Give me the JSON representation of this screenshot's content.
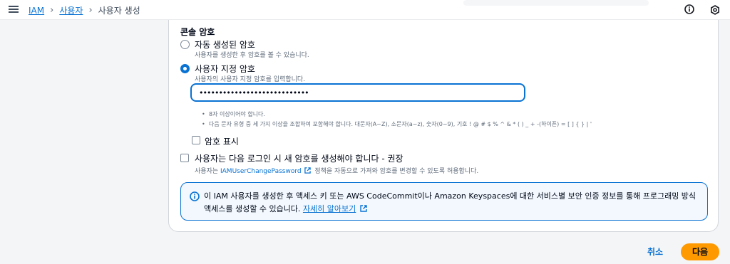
{
  "breadcrumb": {
    "iam": "IAM",
    "users": "사용자",
    "current": "사용자 생성"
  },
  "console_password": {
    "title": "콘솔 암호",
    "auto": {
      "label": "자동 생성된 암호",
      "desc": "사용자를 생성한 후 암호를 볼 수 있습니다."
    },
    "custom": {
      "label": "사용자 지정 암호",
      "desc": "사용자의 사용자 지정 암호를 입력합니다.",
      "value": "••••••••••••••••••••••••••••"
    },
    "rules": [
      "8자 이상이어야 합니다.",
      "다음 문자 유형 중 세 가지 이상을 조합하여 포함해야 합니다. 대문자(A~Z), 소문자(a~z), 숫자(0~9), 기호 ! @ # $ % ^ & * ( ) _ + -(하이픈) = [ ] { } | '"
    ],
    "show_password": "암호 표시",
    "require_reset": {
      "label": "사용자는 다음 로그인 시 새 암호를 생성해야 합니다 - 권장",
      "desc_prefix": "사용자는",
      "policy_link": "IAMUserChangePassword",
      "desc_suffix": "정책을 자동으로 가져와 암호를 변경할 수 있도록 허용합니다."
    }
  },
  "alert": {
    "text": "이 IAM 사용자를 생성한 후 액세스 키 또는 AWS CodeCommit이나 Amazon Keyspaces에 대한 서비스별 보안 인증 정보를 통해 프로그래밍 방식 액세스를 생성할 수 있습니다.",
    "link": "자세히 알아보기"
  },
  "footer": {
    "cancel": "취소",
    "next": "다음"
  },
  "colors": {
    "accent": "#0972d3",
    "primary_button": "#ff9900"
  }
}
